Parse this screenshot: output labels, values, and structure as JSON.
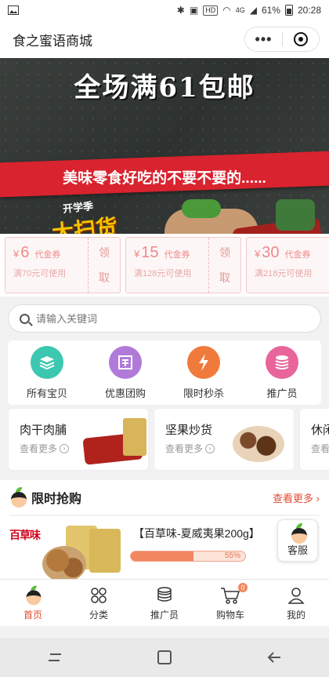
{
  "status_bar": {
    "battery": "61%",
    "time": "20:28",
    "hd_badge": "HD",
    "network": "4G"
  },
  "header": {
    "title": "食之蜜语商城",
    "more_icon": "more-dots-icon",
    "close_icon": "target-icon"
  },
  "banner": {
    "headline": "全场满61包邮",
    "subline": "美味零食好吃的不要不要的......",
    "promo_small": "开学季",
    "promo_big": "大扫货",
    "slide_count": 6,
    "active_slide": 0
  },
  "coupons": [
    {
      "symbol": "¥",
      "amount": "6",
      "tag": "代金券",
      "condition": "满70元可使用",
      "claim_top": "领",
      "claim_bottom": "取"
    },
    {
      "symbol": "¥",
      "amount": "15",
      "tag": "代金券",
      "condition": "满128元可使用",
      "claim_top": "领",
      "claim_bottom": "取"
    },
    {
      "symbol": "¥",
      "amount": "30",
      "tag": "代金券",
      "condition": "满218元可使用",
      "claim_top": "领",
      "claim_bottom": "取"
    }
  ],
  "search": {
    "placeholder": "请输入关键词"
  },
  "categories": [
    {
      "label": "所有宝贝",
      "icon": "layers-icon",
      "color": "#3cc7b0"
    },
    {
      "label": "优惠团购",
      "icon": "group-buy-icon",
      "color": "#b07ad8"
    },
    {
      "label": "限时秒杀",
      "icon": "lightning-icon",
      "color": "#f07a3c"
    },
    {
      "label": "推广员",
      "icon": "coins-icon",
      "color": "#e8649a"
    }
  ],
  "product_categories": [
    {
      "name": "肉干肉脯",
      "more": "查看更多"
    },
    {
      "name": "坚果炒货",
      "more": "查看更多"
    },
    {
      "name": "休闲",
      "more": "查看更多"
    }
  ],
  "flash_sale": {
    "title": "限时抢购",
    "more": "查看更多 ›",
    "item": {
      "brand": "百草味",
      "name": "【百草味-夏威夷果200g】",
      "progress_percent": 55,
      "progress_label": "55%"
    }
  },
  "service_button": {
    "label": "客服"
  },
  "tabbar": [
    {
      "label": "首页",
      "icon": "home-mascot-icon",
      "active": true
    },
    {
      "label": "分类",
      "icon": "category-grid-icon",
      "active": false
    },
    {
      "label": "推广员",
      "icon": "coins-stack-icon",
      "active": false
    },
    {
      "label": "购物车",
      "icon": "cart-icon",
      "active": false,
      "badge": "0"
    },
    {
      "label": "我的",
      "icon": "user-icon",
      "active": false
    }
  ],
  "colors": {
    "accent": "#e24c30",
    "coupon_text": "#f08a8a",
    "progress": "#f2865f"
  }
}
